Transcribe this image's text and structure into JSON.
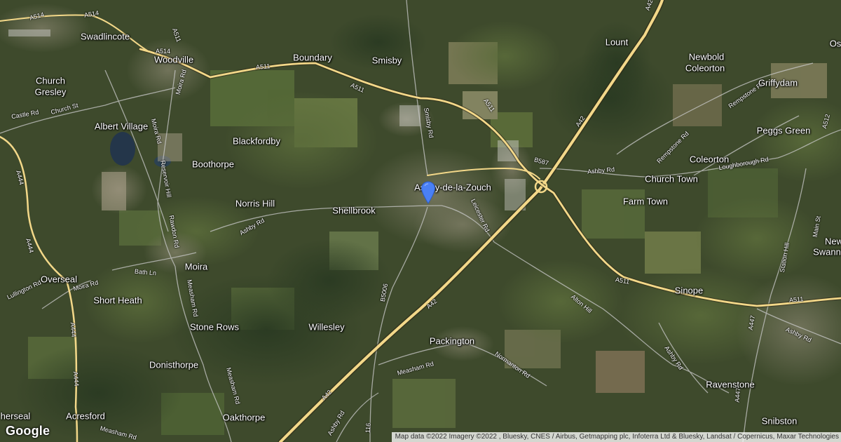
{
  "map": {
    "type": "satellite",
    "marker_icon": "location-pin-icon",
    "marker_color": "#4a80f5",
    "colors": {
      "road_major": "#f3d889",
      "road_minor": "#c9c9c9",
      "terrain_base": "#3e4a2c"
    },
    "places": [
      {
        "name": "Swadlincote"
      },
      {
        "name": "Woodville"
      },
      {
        "name": "Boundary"
      },
      {
        "name": "Smisby"
      },
      {
        "name": "Lount"
      },
      {
        "name": "Newbold"
      },
      {
        "name": "Coleorton"
      },
      {
        "name": "Griffydam"
      },
      {
        "name": "Os"
      },
      {
        "name": "Church"
      },
      {
        "name": "Gresley"
      },
      {
        "name": "Albert Village"
      },
      {
        "name": "Blackfordby"
      },
      {
        "name": "Peggs Green"
      },
      {
        "name": "Boothorpe"
      },
      {
        "name": "Coleorton"
      },
      {
        "name": "Church Town"
      },
      {
        "name": "Ashby-de-la-Zouch"
      },
      {
        "name": "Farm Town"
      },
      {
        "name": "Norris Hill"
      },
      {
        "name": "Shellbrook"
      },
      {
        "name": "New"
      },
      {
        "name": "Swannin"
      },
      {
        "name": "Moira"
      },
      {
        "name": "Overseal"
      },
      {
        "name": "Sinope"
      },
      {
        "name": "Short Heath"
      },
      {
        "name": "Stone Rows"
      },
      {
        "name": "Willesley"
      },
      {
        "name": "Packington"
      },
      {
        "name": "Donisthorpe"
      },
      {
        "name": "Ravenstone"
      },
      {
        "name": "herseal"
      },
      {
        "name": "Acresford"
      },
      {
        "name": "Oakthorpe"
      },
      {
        "name": "Snibston"
      }
    ],
    "roads": [
      {
        "label": "A514"
      },
      {
        "label": "A514"
      },
      {
        "label": "A511"
      },
      {
        "label": "A514"
      },
      {
        "label": "Moira Rd"
      },
      {
        "label": "A511"
      },
      {
        "label": "A511"
      },
      {
        "label": "A511"
      },
      {
        "label": "Smisby Rd"
      },
      {
        "label": "A42"
      },
      {
        "label": "Rempstone Rd"
      },
      {
        "label": "A512"
      },
      {
        "label": "Castle Rd"
      },
      {
        "label": "Church St"
      },
      {
        "label": "Moira Rd"
      },
      {
        "label": "Reservoir Hill"
      },
      {
        "label": "B587"
      },
      {
        "label": "A42"
      },
      {
        "label": "Ashby Rd"
      },
      {
        "label": "Rempstone Rd"
      },
      {
        "label": "Loughborough Rd"
      },
      {
        "label": "A444"
      },
      {
        "label": "Leicester Rd"
      },
      {
        "label": "Ashby Rd"
      },
      {
        "label": "Rawdon Rd"
      },
      {
        "label": "A444"
      },
      {
        "label": "Bath Ln"
      },
      {
        "label": "Main St"
      },
      {
        "label": "Moira Rd"
      },
      {
        "label": "Station Hill"
      },
      {
        "label": "Lullington Rd"
      },
      {
        "label": "Measham Rd"
      },
      {
        "label": "B5006"
      },
      {
        "label": "A42"
      },
      {
        "label": "Alton Hill"
      },
      {
        "label": "A511"
      },
      {
        "label": "A511"
      },
      {
        "label": "A444"
      },
      {
        "label": "A447"
      },
      {
        "label": "Ashby Rd"
      },
      {
        "label": "Ashby Rd"
      },
      {
        "label": "Normanton Rd"
      },
      {
        "label": "Measham Rd"
      },
      {
        "label": "A444"
      },
      {
        "label": "Measham Rd"
      },
      {
        "label": "A42"
      },
      {
        "label": "A447"
      },
      {
        "label": "Ashby Rd"
      },
      {
        "label": "Measham Rd"
      },
      {
        "label": "116"
      }
    ]
  },
  "branding": {
    "logo_text": "Google"
  },
  "attribution": "Map data ©2022 Imagery ©2022 , Bluesky, CNES / Airbus, Getmapping plc, Infoterra Ltd & Bluesky, Landsat / Copernicus, Maxar Technologies"
}
